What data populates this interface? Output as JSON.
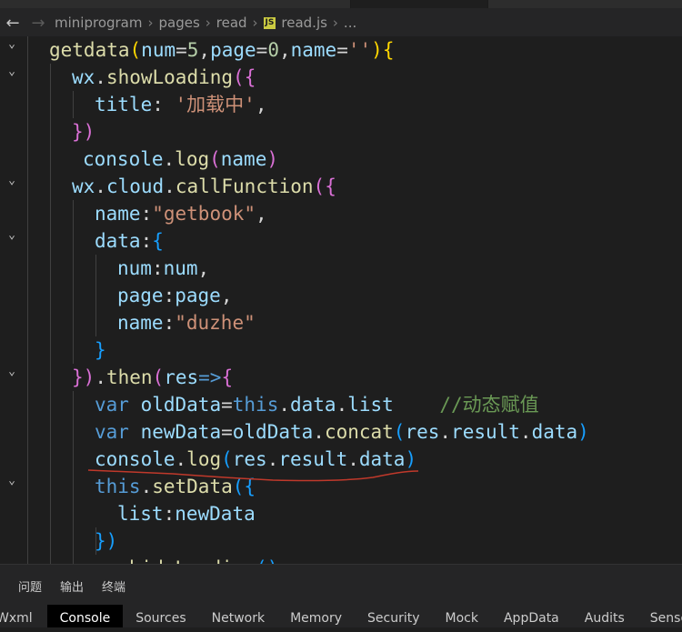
{
  "breadcrumb": {
    "back_icon": "arrow-left-icon",
    "forward_icon": "arrow-right-icon",
    "parts": [
      "miniprogram",
      "pages",
      "read"
    ],
    "file_badge": "JS",
    "file": "read.js",
    "trailing": "..."
  },
  "code_lines": [
    [
      [
        "getdata",
        "#dcdcaa"
      ],
      [
        "(",
        "#ffd700"
      ],
      [
        "num",
        "#9cdcfe"
      ],
      [
        "=",
        "#d4d4d4"
      ],
      [
        "5",
        "#b5cea8"
      ],
      [
        ",",
        "#d4d4d4"
      ],
      [
        "page",
        "#9cdcfe"
      ],
      [
        "=",
        "#d4d4d4"
      ],
      [
        "0",
        "#b5cea8"
      ],
      [
        ",",
        "#d4d4d4"
      ],
      [
        "name",
        "#9cdcfe"
      ],
      [
        "=",
        "#d4d4d4"
      ],
      [
        "''",
        "#ce9178"
      ],
      [
        ")",
        "#ffd700"
      ],
      [
        "{",
        "#ffd700"
      ]
    ],
    [
      [
        "wx",
        "#9cdcfe"
      ],
      [
        ".",
        "#d4d4d4"
      ],
      [
        "showLoading",
        "#dcdcaa"
      ],
      [
        "(",
        "#da70d6"
      ],
      [
        "{",
        "#da70d6"
      ]
    ],
    [
      [
        "title",
        "#9cdcfe"
      ],
      [
        ": ",
        "#d4d4d4"
      ],
      [
        "'加载中'",
        "#ce9178"
      ],
      [
        ",",
        "#d4d4d4"
      ]
    ],
    [
      [
        "}",
        "#da70d6"
      ],
      [
        ")",
        "#da70d6"
      ]
    ],
    [
      [
        "console",
        "#9cdcfe"
      ],
      [
        ".",
        "#d4d4d4"
      ],
      [
        "log",
        "#dcdcaa"
      ],
      [
        "(",
        "#da70d6"
      ],
      [
        "name",
        "#9cdcfe"
      ],
      [
        ")",
        "#da70d6"
      ]
    ],
    [
      [
        "wx",
        "#9cdcfe"
      ],
      [
        ".",
        "#d4d4d4"
      ],
      [
        "cloud",
        "#9cdcfe"
      ],
      [
        ".",
        "#d4d4d4"
      ],
      [
        "callFunction",
        "#dcdcaa"
      ],
      [
        "(",
        "#da70d6"
      ],
      [
        "{",
        "#da70d6"
      ]
    ],
    [
      [
        "name",
        "#9cdcfe"
      ],
      [
        ":",
        "#d4d4d4"
      ],
      [
        "\"getbook\"",
        "#ce9178"
      ],
      [
        ",",
        "#d4d4d4"
      ]
    ],
    [
      [
        "data",
        "#9cdcfe"
      ],
      [
        ":",
        "#d4d4d4"
      ],
      [
        "{",
        "#179fff"
      ]
    ],
    [
      [
        "num",
        "#9cdcfe"
      ],
      [
        ":",
        "#d4d4d4"
      ],
      [
        "num",
        "#9cdcfe"
      ],
      [
        ",",
        "#d4d4d4"
      ]
    ],
    [
      [
        "page",
        "#9cdcfe"
      ],
      [
        ":",
        "#d4d4d4"
      ],
      [
        "page",
        "#9cdcfe"
      ],
      [
        ",",
        "#d4d4d4"
      ]
    ],
    [
      [
        "name",
        "#9cdcfe"
      ],
      [
        ":",
        "#d4d4d4"
      ],
      [
        "\"duzhe\"",
        "#ce9178"
      ]
    ],
    [
      [
        "}",
        "#179fff"
      ]
    ],
    [
      [
        "}",
        "#da70d6"
      ],
      [
        ")",
        "#da70d6"
      ],
      [
        ".",
        "#d4d4d4"
      ],
      [
        "then",
        "#dcdcaa"
      ],
      [
        "(",
        "#da70d6"
      ],
      [
        "res",
        "#9cdcfe"
      ],
      [
        "=>",
        "#569cd6"
      ],
      [
        "{",
        "#da70d6"
      ]
    ],
    [
      [
        "var",
        "#569cd6"
      ],
      [
        " ",
        "#d4d4d4"
      ],
      [
        "oldData",
        "#9cdcfe"
      ],
      [
        "=",
        "#d4d4d4"
      ],
      [
        "this",
        "#569cd6"
      ],
      [
        ".",
        "#d4d4d4"
      ],
      [
        "data",
        "#9cdcfe"
      ],
      [
        ".",
        "#d4d4d4"
      ],
      [
        "list",
        "#9cdcfe"
      ],
      [
        "    ",
        "#d4d4d4"
      ],
      [
        "//动态赋值",
        "#6a9955"
      ]
    ],
    [
      [
        "var",
        "#569cd6"
      ],
      [
        " ",
        "#d4d4d4"
      ],
      [
        "newData",
        "#9cdcfe"
      ],
      [
        "=",
        "#d4d4d4"
      ],
      [
        "oldData",
        "#9cdcfe"
      ],
      [
        ".",
        "#d4d4d4"
      ],
      [
        "concat",
        "#dcdcaa"
      ],
      [
        "(",
        "#179fff"
      ],
      [
        "res",
        "#9cdcfe"
      ],
      [
        ".",
        "#d4d4d4"
      ],
      [
        "result",
        "#9cdcfe"
      ],
      [
        ".",
        "#d4d4d4"
      ],
      [
        "data",
        "#9cdcfe"
      ],
      [
        ")",
        "#179fff"
      ]
    ],
    [
      [
        "console",
        "#9cdcfe"
      ],
      [
        ".",
        "#d4d4d4"
      ],
      [
        "log",
        "#dcdcaa"
      ],
      [
        "(",
        "#179fff"
      ],
      [
        "res",
        "#9cdcfe"
      ],
      [
        ".",
        "#d4d4d4"
      ],
      [
        "result",
        "#9cdcfe"
      ],
      [
        ".",
        "#d4d4d4"
      ],
      [
        "data",
        "#9cdcfe"
      ],
      [
        ")",
        "#179fff"
      ]
    ],
    [
      [
        "this",
        "#569cd6"
      ],
      [
        ".",
        "#d4d4d4"
      ],
      [
        "setData",
        "#dcdcaa"
      ],
      [
        "(",
        "#179fff"
      ],
      [
        "{",
        "#179fff"
      ]
    ],
    [
      [
        "list",
        "#9cdcfe"
      ],
      [
        ":",
        "#d4d4d4"
      ],
      [
        "newData",
        "#9cdcfe"
      ]
    ],
    [
      [
        "}",
        "#179fff"
      ],
      [
        ")",
        "#179fff"
      ]
    ],
    [
      [
        "wx",
        "#9cdcfe"
      ],
      [
        ".",
        "#d4d4d4"
      ],
      [
        "hideLoading",
        "#dcdcaa"
      ],
      [
        "(",
        "#179fff"
      ],
      [
        ")",
        "#179fff"
      ]
    ]
  ],
  "panel_tabs": [
    "问题",
    "输出",
    "终端"
  ],
  "devtools_tabs": [
    "Wxml",
    "Console",
    "Sources",
    "Network",
    "Memory",
    "Security",
    "Mock",
    "AppData",
    "Audits",
    "Sensor"
  ],
  "active_devtools_tab": "Console",
  "colors": {
    "editor_bg": "#1e1e1e",
    "annotation_red": "#c0392b"
  }
}
